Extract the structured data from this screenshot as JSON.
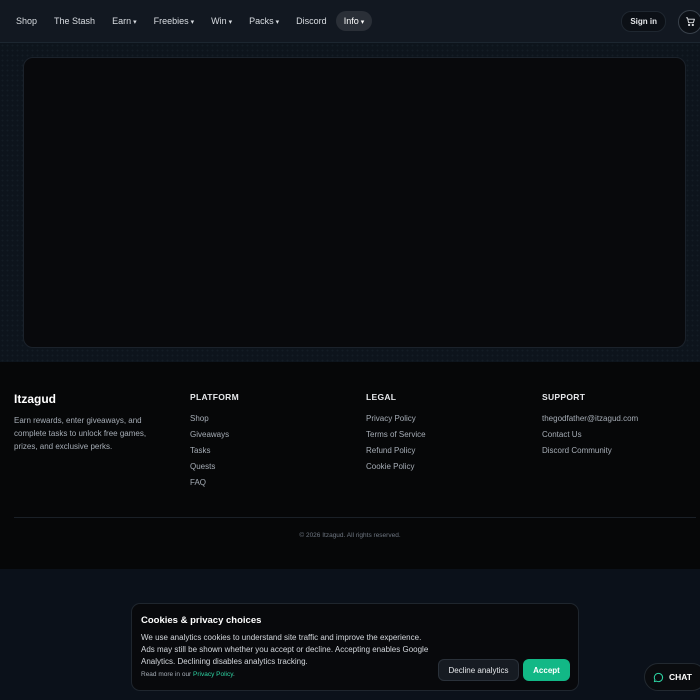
{
  "nav": {
    "items": [
      {
        "label": "Shop",
        "caret": ""
      },
      {
        "label": "The Stash",
        "caret": ""
      },
      {
        "label": "Earn",
        "caret": "▾"
      },
      {
        "label": "Freebies",
        "caret": "▾"
      },
      {
        "label": "Win",
        "caret": "▾"
      },
      {
        "label": "Packs",
        "caret": "▾"
      },
      {
        "label": "Discord",
        "caret": ""
      },
      {
        "label": "Info",
        "caret": "▾"
      }
    ],
    "signin_label": "Sign in",
    "cart_icon": "cart-icon"
  },
  "footer": {
    "brand": "Itzagud",
    "tagline": "Earn rewards, enter giveaways, and complete tasks to unlock free games, prizes, and exclusive perks.",
    "columns": [
      {
        "heading": "PLATFORM",
        "links": [
          "Shop",
          "Giveaways",
          "Tasks",
          "Quests",
          "FAQ"
        ]
      },
      {
        "heading": "LEGAL",
        "links": [
          "Privacy Policy",
          "Terms of Service",
          "Refund Policy",
          "Cookie Policy"
        ]
      },
      {
        "heading": "SUPPORT",
        "links": [
          "thegodfather@itzagud.com",
          "Contact Us",
          "Discord Community"
        ]
      }
    ],
    "copyright": "© 2026 Itzagud. All rights reserved."
  },
  "cookie": {
    "title": "Cookies & privacy choices",
    "body": "We use analytics cookies to understand site traffic and improve the experience. Ads may still be shown whether you accept or decline. Accepting enables Google Analytics. Declining disables analytics tracking.",
    "more_prefix": "Read more in our ",
    "more_link": "Privacy Policy",
    "more_suffix": ".",
    "decline_label": "Decline analytics",
    "accept_label": "Accept"
  },
  "chat": {
    "label": "CHAT",
    "icon": "chat-bubble-icon"
  },
  "colors": {
    "accent": "#12b886",
    "link_accent": "#2dd4a3",
    "page_bg": "#0b111a",
    "footer_bg": "#060708"
  }
}
